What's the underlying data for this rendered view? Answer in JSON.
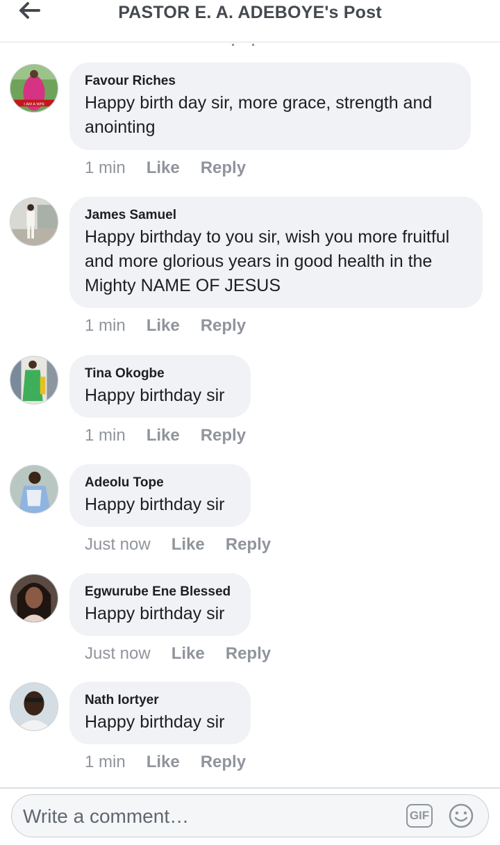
{
  "header": {
    "title": "PASTOR E. A. ADEBOYE's Post"
  },
  "comments": [
    {
      "author": "Favour Riches",
      "text": "Happy birth day sir, more grace, strength and anointing",
      "time": "1 min",
      "like": "Like",
      "reply": "Reply"
    },
    {
      "author": "James Samuel",
      "text": "Happy birthday to you sir, wish you more fruitful and more glorious years in good health in the Mighty NAME OF JESUS",
      "time": "1 min",
      "like": "Like",
      "reply": "Reply"
    },
    {
      "author": "Tina Okogbe",
      "text": "Happy birthday sir",
      "time": "1 min",
      "like": "Like",
      "reply": "Reply"
    },
    {
      "author": "Adeolu Tope",
      "text": "Happy birthday sir",
      "time": "Just now",
      "like": "Like",
      "reply": "Reply"
    },
    {
      "author": "Egwurube Ene Blessed",
      "text": "Happy birthday sir",
      "time": "Just now",
      "like": "Like",
      "reply": "Reply"
    },
    {
      "author": "Nath Iortyer",
      "text": "Happy birthday sir",
      "time": "1 min",
      "like": "Like",
      "reply": "Reply"
    }
  ],
  "composer": {
    "placeholder": "Write a comment…",
    "gif_label": "GIF"
  },
  "icons": {
    "back": "arrow-left-icon",
    "gif": "gif-icon",
    "emoji": "smiley-icon"
  }
}
